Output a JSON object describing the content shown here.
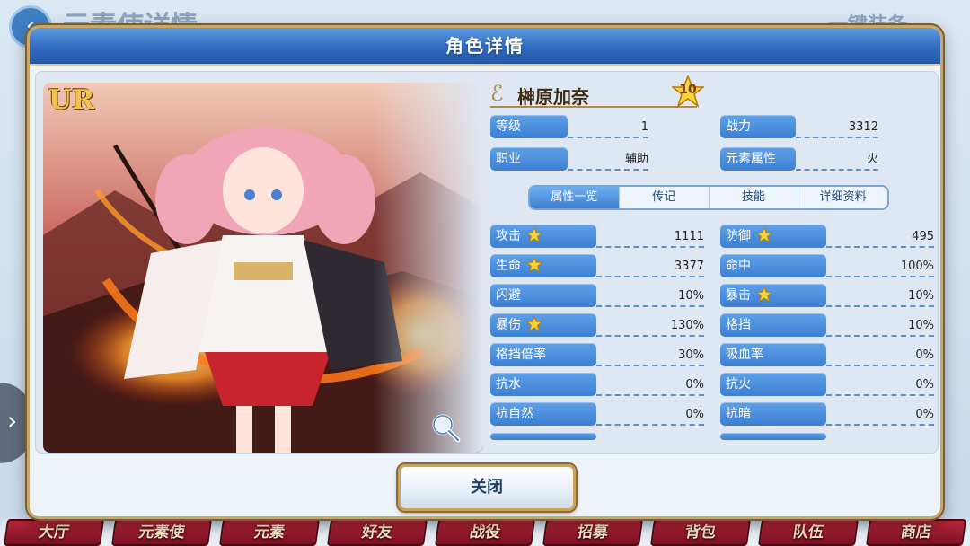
{
  "background": {
    "title": "元素使详情",
    "equip_label": "一键装备",
    "back_icon": "back-arrow-icon"
  },
  "dialog": {
    "title": "角色详情",
    "close_label": "关闭"
  },
  "character": {
    "rarity": "UR",
    "name": "榊原加奈",
    "star_level": "10"
  },
  "fields": {
    "level_label": "等级",
    "level_value": "1",
    "power_label": "战力",
    "power_value": "3312",
    "class_label": "职业",
    "class_value": "辅助",
    "element_label": "元素属性",
    "element_value": "火"
  },
  "tabs": [
    {
      "label": "属性一览",
      "active": true
    },
    {
      "label": "传记",
      "active": false
    },
    {
      "label": "技能",
      "active": false
    },
    {
      "label": "详细资料",
      "active": false
    }
  ],
  "stats": [
    {
      "label": "攻击",
      "value": "1111",
      "star": true
    },
    {
      "label": "防御",
      "value": "495",
      "star": true
    },
    {
      "label": "生命",
      "value": "3377",
      "star": true
    },
    {
      "label": "命中",
      "value": "100%",
      "star": false
    },
    {
      "label": "闪避",
      "value": "10%",
      "star": false
    },
    {
      "label": "暴击",
      "value": "10%",
      "star": true
    },
    {
      "label": "暴伤",
      "value": "130%",
      "star": true
    },
    {
      "label": "格挡",
      "value": "10%",
      "star": false
    },
    {
      "label": "格挡倍率",
      "value": "30%",
      "star": false
    },
    {
      "label": "吸血率",
      "value": "0%",
      "star": false
    },
    {
      "label": "抗水",
      "value": "0%",
      "star": false
    },
    {
      "label": "抗火",
      "value": "0%",
      "star": false
    },
    {
      "label": "抗自然",
      "value": "0%",
      "star": false
    },
    {
      "label": "抗暗",
      "value": "0%",
      "star": false
    }
  ],
  "bottom_nav": [
    "大厅",
    "元素使",
    "元素",
    "好友",
    "战役",
    "招募",
    "背包",
    "队伍",
    "商店"
  ],
  "colors": {
    "header_blue": "#2f6bc0",
    "label_blue": "#3c7fd2",
    "gold_border": "#c8a86a",
    "nav_red": "#9b1a2e"
  },
  "icons": {
    "zoom": "magnifier-icon",
    "star": "star-icon",
    "side_arrow": "chevron-right-icon"
  }
}
